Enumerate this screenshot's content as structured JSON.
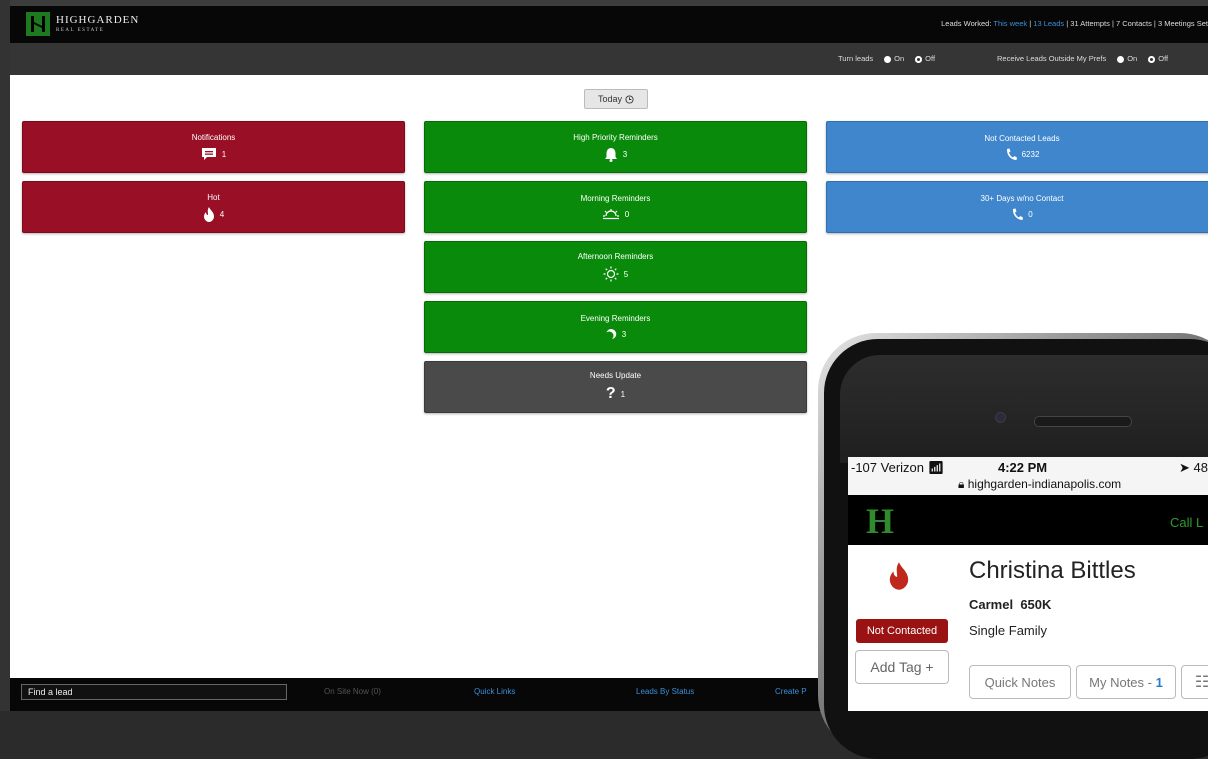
{
  "header": {
    "logo_name": "HIGHGARDEN",
    "logo_sub": "REAL ESTATE",
    "stats_prefix": "Leads Worked: ",
    "stats_period": "This week",
    "stats_sep1": " | ",
    "stats_leads": "13 Leads",
    "stats_rest": " | 31 Attempts | 7 Contacts | 3 Meetings Set"
  },
  "subbar": {
    "turn_leads": "Turn leads",
    "receive_outside": "Receive Leads Outside My Prefs",
    "on": "On",
    "off": "Off"
  },
  "main": {
    "today_label": "Today",
    "tiles": {
      "notifications": {
        "label": "Notifications",
        "count": "1"
      },
      "hot": {
        "label": "Hot",
        "count": "4"
      },
      "high_priority": {
        "label": "High Priority Reminders",
        "count": "3"
      },
      "morning": {
        "label": "Morning Reminders",
        "count": "0"
      },
      "afternoon": {
        "label": "Afternoon Reminders",
        "count": "5"
      },
      "evening": {
        "label": "Evening Reminders",
        "count": "3"
      },
      "needs_update": {
        "label": "Needs Update",
        "count": "1"
      },
      "not_contacted": {
        "label": "Not Contacted Leads",
        "count": "6232"
      },
      "thirty_days": {
        "label": "30+ Days w/no Contact",
        "count": "0"
      }
    }
  },
  "footer": {
    "find_placeholder": "Find a lead",
    "on_site_now": "On Site Now (0)",
    "quick_links": "Quick Links",
    "leads_by_status": "Leads By Status",
    "create": "Create P"
  },
  "phone": {
    "carrier": "-107 Verizon",
    "time": "4:22 PM",
    "battery_partial": "48",
    "url": "highgarden-indianapolis.com",
    "app_logo": "H",
    "call_label": "Call L",
    "lead_name": "Christina Bittles",
    "city": "Carmel",
    "price": "650K",
    "property_type": "Single Family",
    "status": "Not Contacted",
    "add_tag": "Add Tag +",
    "quick_notes": "Quick Notes",
    "my_notes": "My Notes - ",
    "my_notes_count": "1"
  },
  "colors": {
    "red_tile": "#990f26",
    "green_tile": "#0a8a0a",
    "blue_tile": "#3f86cc",
    "gray_tile": "#4a4a4a",
    "link_blue": "#3d8fd8"
  }
}
